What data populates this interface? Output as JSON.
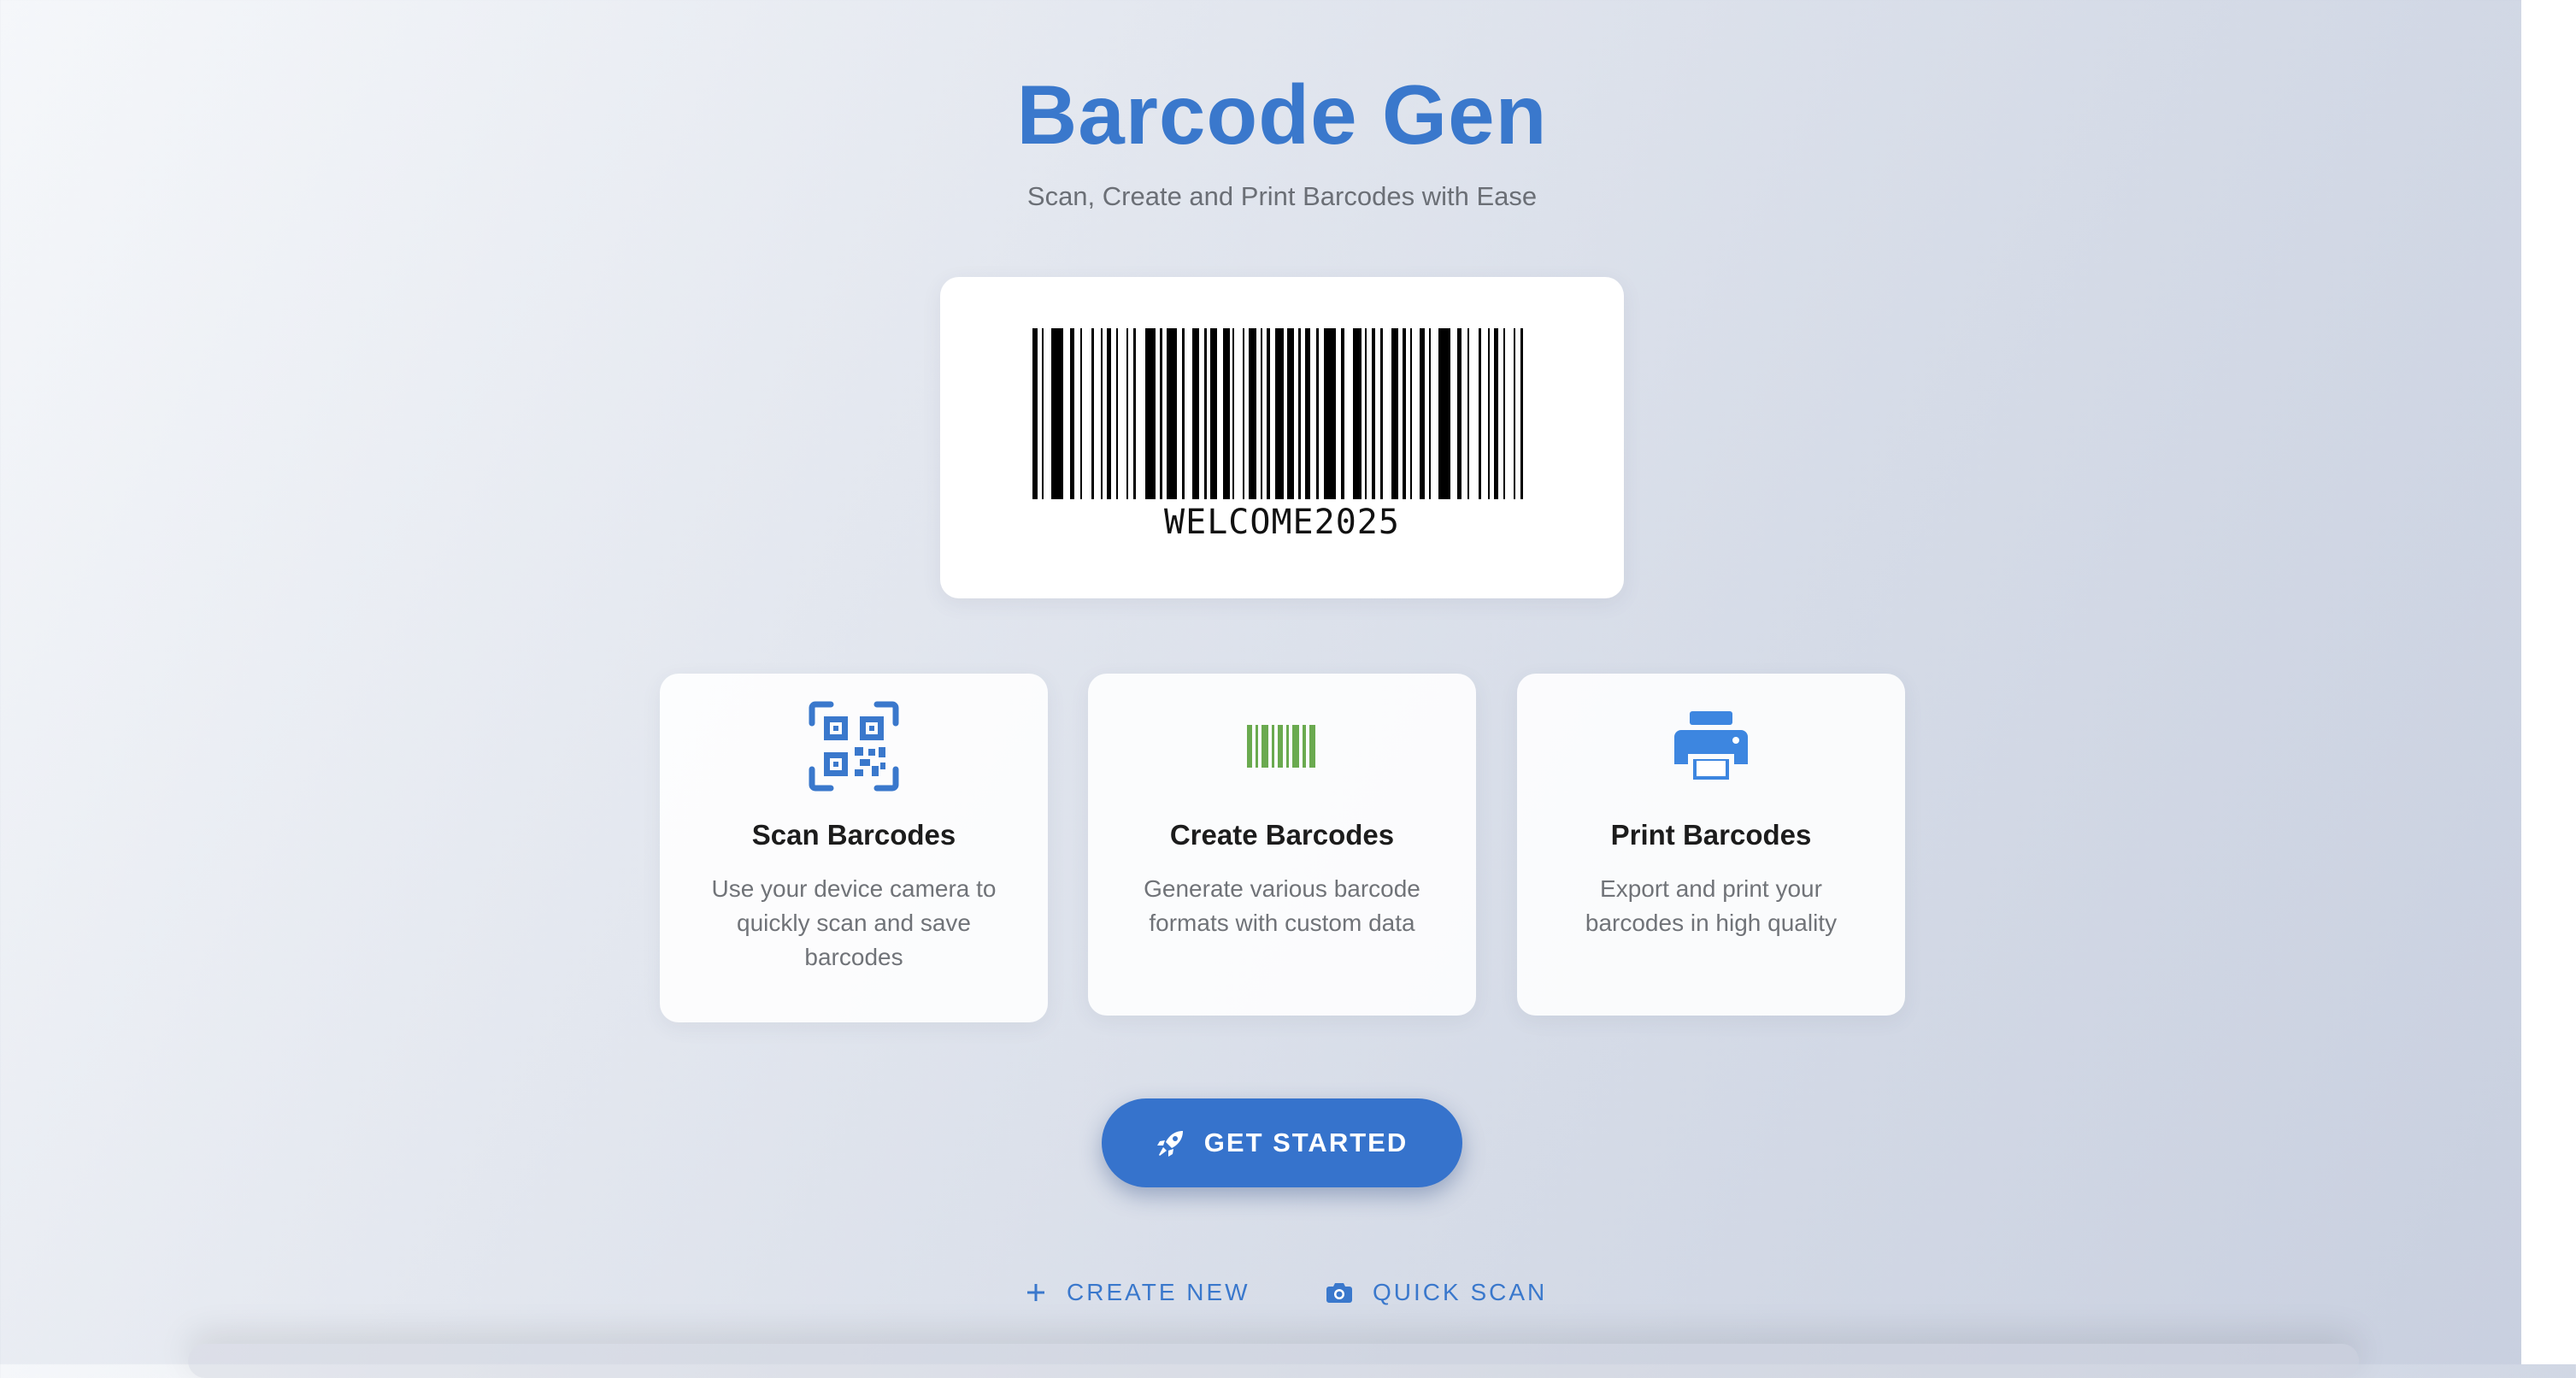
{
  "header": {
    "title": "Barcode Gen",
    "subtitle": "Scan, Create and Print Barcodes with Ease"
  },
  "barcode_preview": {
    "value": "WELCOME2025"
  },
  "features": [
    {
      "icon": "qr-code-icon",
      "title": "Scan Barcodes",
      "description": "Use your device camera to quickly scan and save barcodes"
    },
    {
      "icon": "barcode-icon",
      "title": "Create Barcodes",
      "description": "Generate various barcode formats with custom data"
    },
    {
      "icon": "printer-icon",
      "title": "Print Barcodes",
      "description": "Export and print your barcodes in high quality"
    }
  ],
  "actions": {
    "primary": {
      "label": "GET STARTED",
      "icon": "rocket-icon"
    },
    "secondary": [
      {
        "label": "CREATE NEW",
        "icon": "plus-icon"
      },
      {
        "label": "QUICK SCAN",
        "icon": "camera-icon"
      }
    ]
  },
  "colors": {
    "brand": "#3a78cc",
    "button": "#3673cc",
    "barcode_icon": "#6aaa4f",
    "printer_icon": "#3d86e0"
  }
}
